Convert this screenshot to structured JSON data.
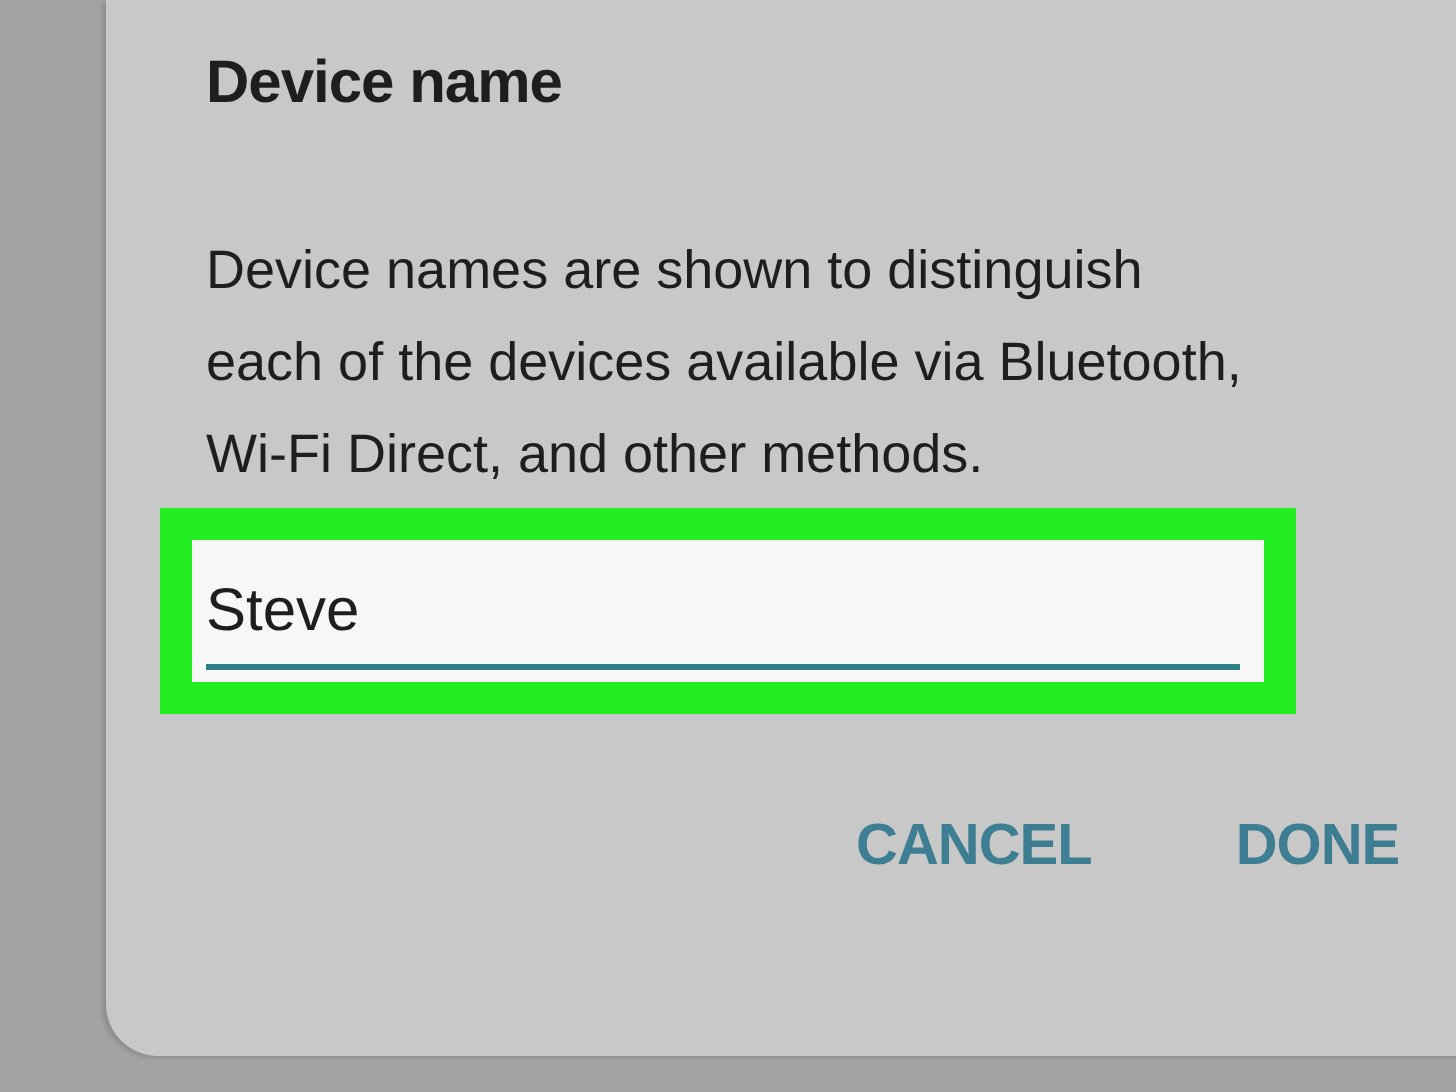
{
  "dialog": {
    "title": "Device name",
    "message": "Device names are shown to distinguish each of the devices available via Bluetooth, Wi-Fi Direct, and other methods.",
    "field": {
      "value": "Steve",
      "highlighted": true
    },
    "buttons": [
      "CANCEL",
      "DONE"
    ]
  }
}
